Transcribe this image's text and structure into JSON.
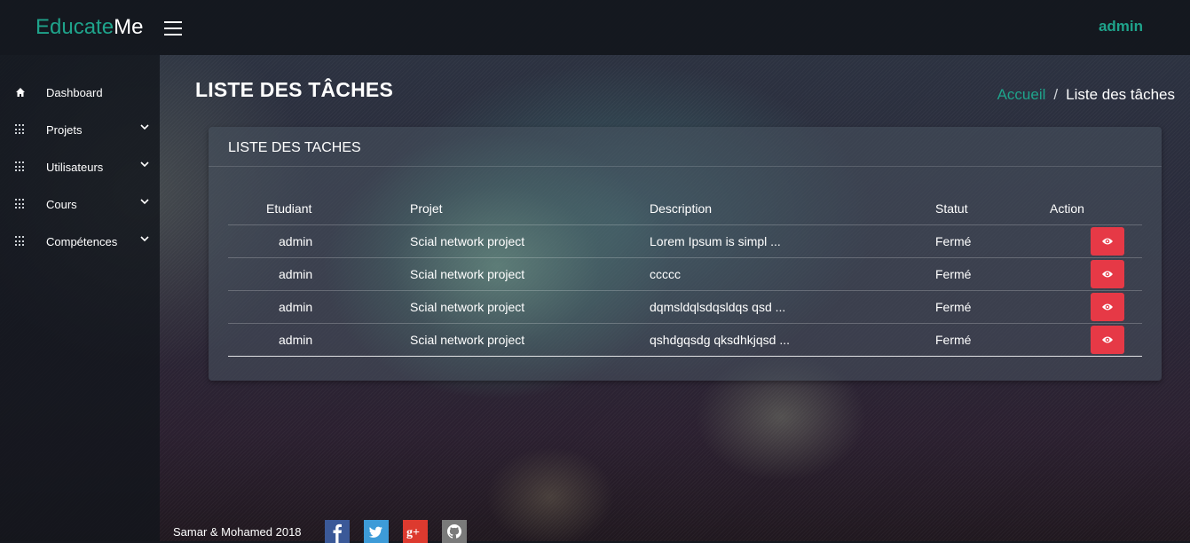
{
  "brand": {
    "part1": "Educate",
    "part2": "Me"
  },
  "header": {
    "user": "admin"
  },
  "sidebar": {
    "items": [
      {
        "label": "Dashboard",
        "icon": "home-icon"
      },
      {
        "label": "Projets",
        "icon": "grid-icon"
      },
      {
        "label": "Utilisateurs",
        "icon": "grid-icon"
      },
      {
        "label": "Cours",
        "icon": "grid-icon"
      },
      {
        "label": "Compétences",
        "icon": "grid-icon"
      }
    ]
  },
  "page": {
    "title": "LISTE DES TÂCHES",
    "breadcrumb": {
      "home": "Accueil",
      "separator": "/",
      "current": "Liste des tâches"
    }
  },
  "card": {
    "title": "LISTE DES TACHES",
    "columns": [
      "Etudiant",
      "Projet",
      "Description",
      "Statut",
      "Action"
    ],
    "rows": [
      {
        "etudiant": "admin",
        "projet": "Scial network project",
        "description": "Lorem Ipsum is simpl ...",
        "statut": "Fermé"
      },
      {
        "etudiant": "admin",
        "projet": "Scial network project",
        "description": "ccccc",
        "statut": "Fermé"
      },
      {
        "etudiant": "admin",
        "projet": "Scial network project",
        "description": "dqmsldqlsdqsldqs qsd ...",
        "statut": "Fermé"
      },
      {
        "etudiant": "admin",
        "projet": "Scial network project",
        "description": "qshdgqsdg qksdhkjqsd ...",
        "statut": "Fermé"
      }
    ]
  },
  "footer": {
    "text": "Samar & Mohamed 2018",
    "social": [
      "facebook-icon",
      "twitter-icon",
      "google-plus-icon",
      "github-icon"
    ]
  },
  "colors": {
    "accent": "#1fa38b",
    "danger": "#e63946"
  }
}
